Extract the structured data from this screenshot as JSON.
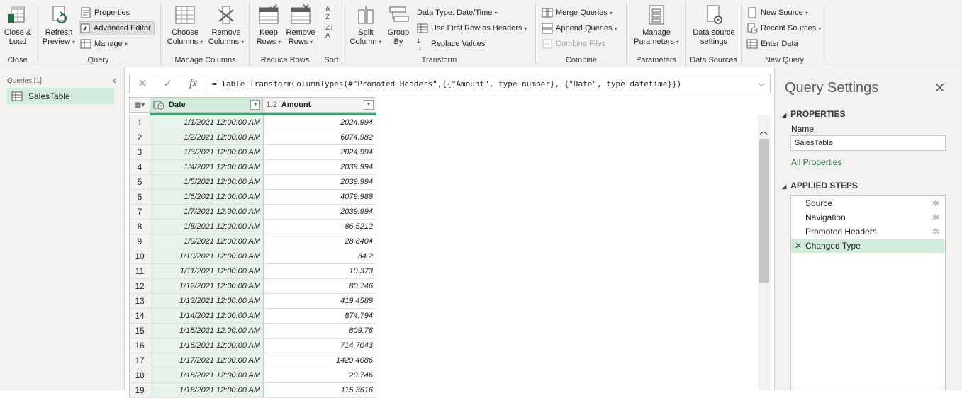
{
  "ribbon": {
    "close": {
      "label": "Close &\nLoad",
      "group": "Close"
    },
    "query": {
      "refresh": "Refresh\nPreview",
      "properties": "Properties",
      "advanced_editor": "Advanced Editor",
      "manage": "Manage",
      "group": "Query"
    },
    "manage_columns": {
      "choose": "Choose\nColumns",
      "remove": "Remove\nColumns",
      "group": "Manage Columns"
    },
    "reduce_rows": {
      "keep": "Keep\nRows",
      "remove": "Remove\nRows",
      "group": "Reduce Rows"
    },
    "sort": {
      "group": "Sort"
    },
    "transform": {
      "split": "Split\nColumn",
      "group_by": "Group\nBy",
      "data_type": "Data Type: Date/Time",
      "first_row": "Use First Row as Headers",
      "replace": "Replace Values",
      "group": "Transform"
    },
    "combine": {
      "merge": "Merge Queries",
      "append": "Append Queries",
      "combine_files": "Combine Files",
      "group": "Combine"
    },
    "parameters": {
      "manage": "Manage\nParameters",
      "group": "Parameters"
    },
    "data_sources": {
      "settings": "Data source\nsettings",
      "group": "Data Sources"
    },
    "new_query": {
      "new_source": "New Source",
      "recent_sources": "Recent Sources",
      "enter_data": "Enter Data",
      "group": "New Query"
    }
  },
  "queries": {
    "title": "Queries [1]",
    "items": [
      {
        "label": "SalesTable"
      }
    ]
  },
  "formula": {
    "text": "= Table.TransformColumnTypes(#\"Promoted Headers\",{{\"Amount\", type number}, {\"Date\", type datetime}})"
  },
  "grid": {
    "columns": [
      {
        "name": "Date",
        "type_icon": "calendar-clock-icon"
      },
      {
        "name": "Amount",
        "type_label": "1.2"
      }
    ],
    "rows": [
      {
        "n": "1",
        "date": "1/1/2021 12:00:00 AM",
        "amount": "2024.994"
      },
      {
        "n": "2",
        "date": "1/2/2021 12:00:00 AM",
        "amount": "6074.982"
      },
      {
        "n": "3",
        "date": "1/3/2021 12:00:00 AM",
        "amount": "2024.994"
      },
      {
        "n": "4",
        "date": "1/4/2021 12:00:00 AM",
        "amount": "2039.994"
      },
      {
        "n": "5",
        "date": "1/5/2021 12:00:00 AM",
        "amount": "2039.994"
      },
      {
        "n": "6",
        "date": "1/6/2021 12:00:00 AM",
        "amount": "4079.988"
      },
      {
        "n": "7",
        "date": "1/7/2021 12:00:00 AM",
        "amount": "2039.994"
      },
      {
        "n": "8",
        "date": "1/8/2021 12:00:00 AM",
        "amount": "86.5212"
      },
      {
        "n": "9",
        "date": "1/9/2021 12:00:00 AM",
        "amount": "28.8404"
      },
      {
        "n": "10",
        "date": "1/10/2021 12:00:00 AM",
        "amount": "34.2"
      },
      {
        "n": "11",
        "date": "1/11/2021 12:00:00 AM",
        "amount": "10.373"
      },
      {
        "n": "12",
        "date": "1/12/2021 12:00:00 AM",
        "amount": "80.746"
      },
      {
        "n": "13",
        "date": "1/13/2021 12:00:00 AM",
        "amount": "419.4589"
      },
      {
        "n": "14",
        "date": "1/14/2021 12:00:00 AM",
        "amount": "874.794"
      },
      {
        "n": "15",
        "date": "1/15/2021 12:00:00 AM",
        "amount": "809.76"
      },
      {
        "n": "16",
        "date": "1/16/2021 12:00:00 AM",
        "amount": "714.7043"
      },
      {
        "n": "17",
        "date": "1/17/2021 12:00:00 AM",
        "amount": "1429.4086"
      },
      {
        "n": "18",
        "date": "1/18/2021 12:00:00 AM",
        "amount": "20.746"
      },
      {
        "n": "19",
        "date": "1/18/2021 12:00:00 AM",
        "amount": "115.3616"
      }
    ]
  },
  "settings": {
    "title": "Query Settings",
    "properties_title": "PROPERTIES",
    "name_label": "Name",
    "name_value": "SalesTable",
    "all_properties": "All Properties",
    "steps_title": "APPLIED STEPS",
    "steps": [
      {
        "label": "Source",
        "has_gear": true,
        "selected": false
      },
      {
        "label": "Navigation",
        "has_gear": true,
        "selected": false
      },
      {
        "label": "Promoted Headers",
        "has_gear": true,
        "selected": false
      },
      {
        "label": "Changed Type",
        "has_gear": false,
        "selected": true
      }
    ]
  },
  "colors": {
    "accent": "#217346",
    "selection": "#d3ebdd",
    "quality_bar": "#41a374"
  }
}
